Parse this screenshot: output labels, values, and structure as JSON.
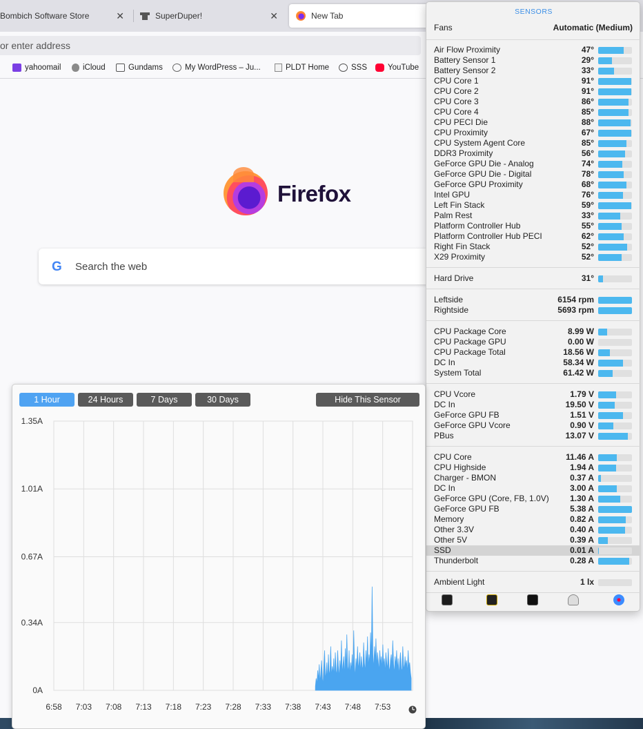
{
  "browser": {
    "tabs": [
      {
        "title": "Bombich Software Store"
      },
      {
        "title": "SuperDuper!"
      },
      {
        "title": "New Tab"
      }
    ],
    "url_placeholder": "or enter address",
    "bookmarks": [
      {
        "label": "yahoomail",
        "icon": "mail-icon"
      },
      {
        "label": "iCloud",
        "icon": "apple-icon"
      },
      {
        "label": "Gundams",
        "icon": "folder-icon"
      },
      {
        "label": "My WordPress – Ju...",
        "icon": "wordpress-icon"
      },
      {
        "label": "PLDT Home",
        "icon": "document-icon"
      },
      {
        "label": "SSS",
        "icon": "globe-icon"
      },
      {
        "label": "YouTube",
        "icon": "youtube-icon"
      }
    ],
    "newtab": {
      "wordmark": "Firefox",
      "search_placeholder": "Search the web",
      "search_engine_glyph": "G"
    }
  },
  "sensors": {
    "title": "SENSORS",
    "fans_label": "Fans",
    "fans_value": "Automatic (Medium)",
    "groups": [
      {
        "rows": [
          {
            "name": "Air Flow Proximity",
            "value": "47°",
            "level": 0.76
          },
          {
            "name": "Battery Sensor 1",
            "value": "29°",
            "level": 0.4
          },
          {
            "name": "Battery Sensor 2",
            "value": "33°",
            "level": 0.46
          },
          {
            "name": "CPU Core 1",
            "value": "91°",
            "level": 0.98
          },
          {
            "name": "CPU Core 2",
            "value": "91°",
            "level": 0.98
          },
          {
            "name": "CPU Core 3",
            "value": "86°",
            "level": 0.9
          },
          {
            "name": "CPU Core 4",
            "value": "85°",
            "level": 0.9
          },
          {
            "name": "CPU PECI Die",
            "value": "88°",
            "level": 0.96
          },
          {
            "name": "CPU Proximity",
            "value": "67°",
            "level": 0.98
          },
          {
            "name": "CPU System Agent Core",
            "value": "85°",
            "level": 0.84
          },
          {
            "name": "DDR3 Proximity",
            "value": "56°",
            "level": 0.8
          },
          {
            "name": "GeForce GPU Die - Analog",
            "value": "74°",
            "level": 0.72
          },
          {
            "name": "GeForce GPU Die - Digital",
            "value": "78°",
            "level": 0.76
          },
          {
            "name": "GeForce GPU Proximity",
            "value": "68°",
            "level": 0.84
          },
          {
            "name": "Intel GPU",
            "value": "76°",
            "level": 0.74
          },
          {
            "name": "Left Fin Stack",
            "value": "59°",
            "level": 0.98
          },
          {
            "name": "Palm Rest",
            "value": "33°",
            "level": 0.66
          },
          {
            "name": "Platform Controller Hub",
            "value": "55°",
            "level": 0.7
          },
          {
            "name": "Platform Controller Hub PECI",
            "value": "62°",
            "level": 0.76
          },
          {
            "name": "Right Fin Stack",
            "value": "52°",
            "level": 0.86
          },
          {
            "name": "X29 Proximity",
            "value": "52°",
            "level": 0.7
          }
        ]
      },
      {
        "rows": [
          {
            "name": "Hard Drive",
            "value": "31°",
            "level": 0.14
          }
        ]
      },
      {
        "rows": [
          {
            "name": "Leftside",
            "value": "6154 rpm",
            "level": 1.0
          },
          {
            "name": "Rightside",
            "value": "5693 rpm",
            "level": 1.0
          }
        ]
      },
      {
        "rows": [
          {
            "name": "CPU Package Core",
            "value": "8.99 W",
            "level": 0.26
          },
          {
            "name": "CPU Package GPU",
            "value": "0.00 W",
            "level": 0.0
          },
          {
            "name": "CPU Package Total",
            "value": "18.56 W",
            "level": 0.34
          },
          {
            "name": "DC In",
            "value": "58.34 W",
            "level": 0.74
          },
          {
            "name": "System Total",
            "value": "61.42 W",
            "level": 0.42
          }
        ]
      },
      {
        "rows": [
          {
            "name": "CPU Vcore",
            "value": "1.79 V",
            "level": 0.54
          },
          {
            "name": "DC In",
            "value": "19.50 V",
            "level": 0.48
          },
          {
            "name": "GeForce GPU FB",
            "value": "1.51 V",
            "level": 0.74
          },
          {
            "name": "GeForce GPU Vcore",
            "value": "0.90 V",
            "level": 0.44
          },
          {
            "name": "PBus",
            "value": "13.07 V",
            "level": 0.88
          }
        ]
      },
      {
        "rows": [
          {
            "name": "CPU Core",
            "value": "11.46 A",
            "level": 0.56
          },
          {
            "name": "CPU Highside",
            "value": "1.94 A",
            "level": 0.54
          },
          {
            "name": "Charger - BMON",
            "value": "0.37 A",
            "level": 0.08
          },
          {
            "name": "DC In",
            "value": "3.00 A",
            "level": 0.56
          },
          {
            "name": "GeForce GPU (Core, FB, 1.0V)",
            "value": "1.30 A",
            "level": 0.66
          },
          {
            "name": "GeForce GPU FB",
            "value": "5.38 A",
            "level": 1.0
          },
          {
            "name": "Memory",
            "value": "0.82 A",
            "level": 0.82
          },
          {
            "name": "Other 3.3V",
            "value": "0.40 A",
            "level": 0.8
          },
          {
            "name": "Other 5V",
            "value": "0.39 A",
            "level": 0.28
          },
          {
            "name": "SSD",
            "value": "0.01 A",
            "level": 0.02,
            "highlighted": true
          },
          {
            "name": "Thunderbolt",
            "value": "0.28 A",
            "level": 0.92
          }
        ]
      },
      {
        "rows": [
          {
            "name": "Ambient Light",
            "value": "1 lx",
            "level": 0.0
          }
        ]
      }
    ],
    "dock_icons": [
      "activity-monitor-icon",
      "console-icon",
      "terminal-icon",
      "automator-icon",
      "safari-icon"
    ]
  },
  "graph_panel": {
    "buttons": [
      {
        "label": "1 Hour",
        "active": true
      },
      {
        "label": "24 Hours",
        "active": false
      },
      {
        "label": "7 Days",
        "active": false
      },
      {
        "label": "30 Days",
        "active": false
      }
    ],
    "hide_label": "Hide This Sensor",
    "clock_icon": "clock-icon"
  },
  "chart_data": {
    "type": "area",
    "title": "",
    "xlabel": "",
    "ylabel": "",
    "y_ticks": [
      "1.35A",
      "1.01A",
      "0.67A",
      "0.34A",
      "0A"
    ],
    "y_tick_values": [
      1.35,
      1.01,
      0.67,
      0.34,
      0
    ],
    "x_ticks": [
      "6:58",
      "7:03",
      "7:08",
      "7:13",
      "7:18",
      "7:23",
      "7:28",
      "7:33",
      "7:38",
      "7:43",
      "7:48",
      "7:53"
    ],
    "ylim": [
      0,
      1.35
    ],
    "grid": true,
    "color": "#4aa5f0",
    "series": [
      {
        "values": [
          0.02,
          0.06,
          0.03,
          0.1,
          0.05,
          0.13,
          0.04,
          0.08,
          0.15,
          0.06,
          0.03,
          0.12,
          0.2,
          0.05,
          0.09,
          0.14,
          0.04,
          0.18,
          0.07,
          0.1,
          0.22,
          0.06,
          0.12,
          0.08,
          0.16,
          0.05,
          0.19,
          0.1,
          0.07,
          0.2,
          0.12,
          0.06,
          0.15,
          0.09,
          0.25,
          0.08,
          0.13,
          0.17,
          0.06,
          0.21,
          0.1,
          0.28,
          0.12,
          0.09,
          0.2,
          0.07,
          0.14,
          0.1,
          0.18,
          0.08,
          0.3,
          0.13,
          0.06,
          0.16,
          0.11,
          0.22,
          0.1,
          0.14,
          0.19,
          0.08,
          0.17,
          0.12,
          0.1,
          0.24,
          0.14,
          0.09,
          0.2,
          0.12,
          0.27,
          0.1,
          0.18,
          0.13,
          0.29,
          0.15,
          0.52,
          0.18,
          0.1,
          0.22,
          0.14,
          0.26,
          0.11,
          0.19,
          0.15,
          0.09,
          0.2,
          0.13,
          0.17,
          0.1,
          0.23,
          0.12,
          0.16,
          0.08,
          0.19,
          0.14,
          0.1,
          0.21,
          0.12,
          0.09,
          0.15,
          0.18,
          0.11,
          0.25,
          0.13,
          0.08,
          0.17,
          0.12,
          0.2,
          0.1,
          0.16,
          0.07,
          0.14,
          0.19,
          0.11,
          0.09,
          0.22,
          0.13,
          0.1,
          0.17,
          0.12,
          0.15,
          0.08,
          0.2,
          0.11,
          0.14,
          0.09,
          0.06
        ]
      }
    ]
  }
}
